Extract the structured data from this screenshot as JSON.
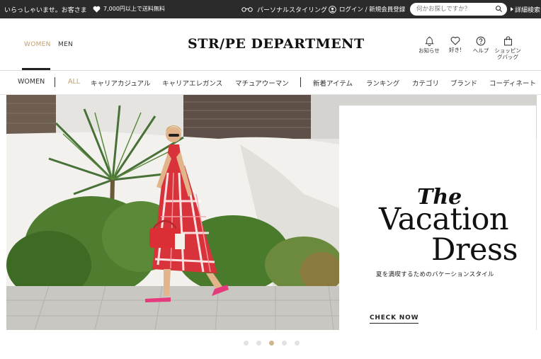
{
  "topbar": {
    "greeting": "いらっしゃいませ。お客さま",
    "shipping": "7,000円以上で送料無料",
    "personal_styling": "パーソナルスタイリング",
    "login": "ログイン / 新規会員登録",
    "search_placeholder": "何かお探しですか？",
    "advanced_search": "詳細検索"
  },
  "header": {
    "gender_tabs": [
      "WOMEN",
      "MEN"
    ],
    "active_gender": "WOMEN",
    "logo": "STR/PE DEPARTMENT",
    "icons": [
      {
        "name": "bell-icon",
        "label": "お知らせ"
      },
      {
        "name": "heart-icon",
        "label": "好き!"
      },
      {
        "name": "help-icon",
        "label": "ヘルプ"
      },
      {
        "name": "bag-icon",
        "label": "ショッピングバッグ"
      }
    ]
  },
  "nav": {
    "items": [
      "WOMEN",
      "ALL",
      "キャリアカジュアル",
      "キャリアエレガンス",
      "マチュアウーマン",
      "新着アイテム",
      "ランキング",
      "カテゴリ",
      "ブランド",
      "コーディネート"
    ],
    "active": "ALL"
  },
  "hero": {
    "title_line1": "The",
    "title_line2": "Vacation",
    "title_line3": "Dress",
    "subtitle": "夏を満喫するためのバケーションスタイル",
    "cta": "CHECK NOW",
    "slide_count": 5,
    "active_slide": 3
  },
  "colors": {
    "topbar_bg": "#2b2b2b",
    "accent_gold": "#c4a06a",
    "active_dot": "#cdb58a",
    "dress_red": "#d8323a"
  }
}
